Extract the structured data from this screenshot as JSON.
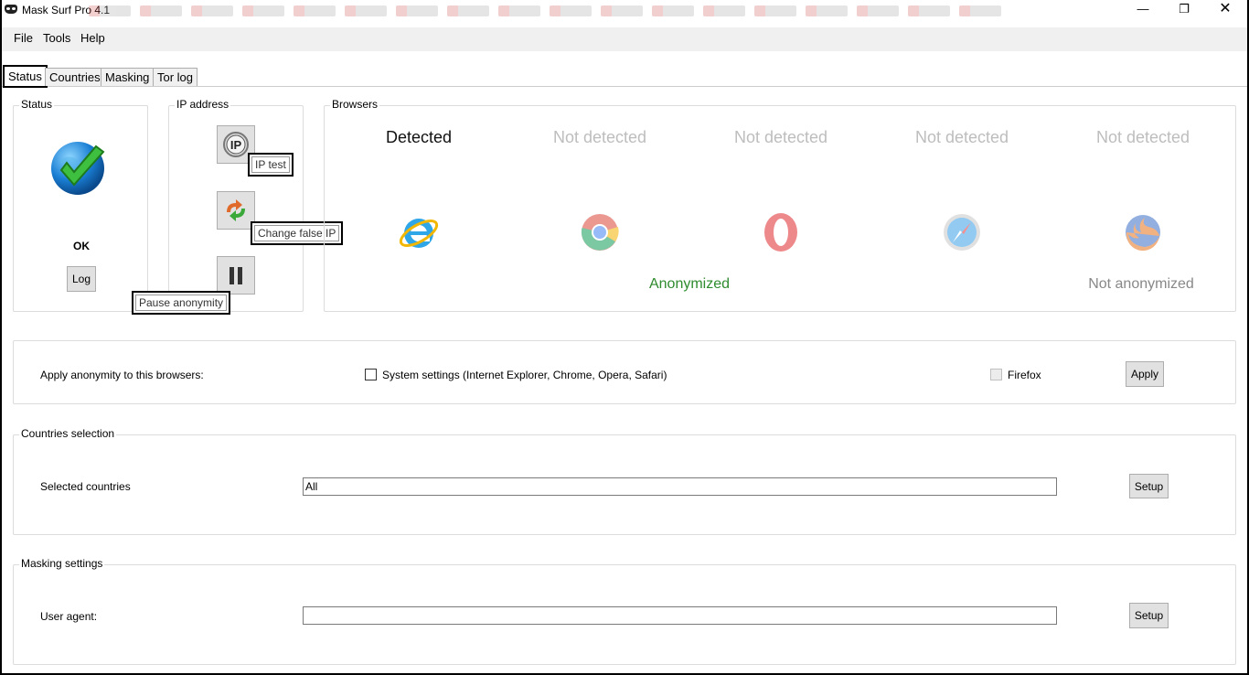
{
  "window": {
    "title": "Mask Surf Pro 4.1",
    "controls": {
      "minimize": "—",
      "maximize": "❐",
      "close": "✕"
    }
  },
  "menu": [
    "File",
    "Tools",
    "Help"
  ],
  "tabs": [
    "Status",
    "Countries",
    "Masking",
    "Tor log"
  ],
  "active_tab": "Status",
  "status_group": {
    "label": "Status",
    "state_icon": "check-globe-icon",
    "state_text": "OK",
    "log_button": "Log"
  },
  "ip_group": {
    "label": "IP address",
    "ip_test_icon": "IP",
    "ip_test_tooltip": "IP test",
    "change_ip_tooltip": "Change false IP",
    "pause_tooltip": "Pause anonymity"
  },
  "browsers_group": {
    "label": "Browsers",
    "browsers": [
      {
        "name": "Internet Explorer",
        "icon": "ie-icon",
        "status": "Detected"
      },
      {
        "name": "Chrome",
        "icon": "chrome-icon",
        "status": "Not detected"
      },
      {
        "name": "Opera",
        "icon": "opera-icon",
        "status": "Not detected"
      },
      {
        "name": "Safari",
        "icon": "safari-icon",
        "status": "Not detected"
      },
      {
        "name": "Firefox",
        "icon": "firefox-icon",
        "status": "Not detected"
      }
    ],
    "system_anonymized": "Anonymized",
    "firefox_anonymized": "Not anonymized",
    "colors": {
      "anonymized": "#2e8b2e",
      "not_anonymized": "#888888"
    }
  },
  "apply_group": {
    "label": "Apply anonymity to this browsers:",
    "system_checkbox_label": "System settings (Internet Explorer, Chrome, Opera, Safari)",
    "firefox_checkbox_label": "Firefox",
    "apply_button": "Apply"
  },
  "countries_group": {
    "label": "Countries selection",
    "field_label": "Selected countries",
    "value": "All",
    "setup_button": "Setup"
  },
  "masking_group": {
    "label": "Masking settings",
    "field_label": "User agent:",
    "value": "",
    "setup_button": "Setup"
  }
}
